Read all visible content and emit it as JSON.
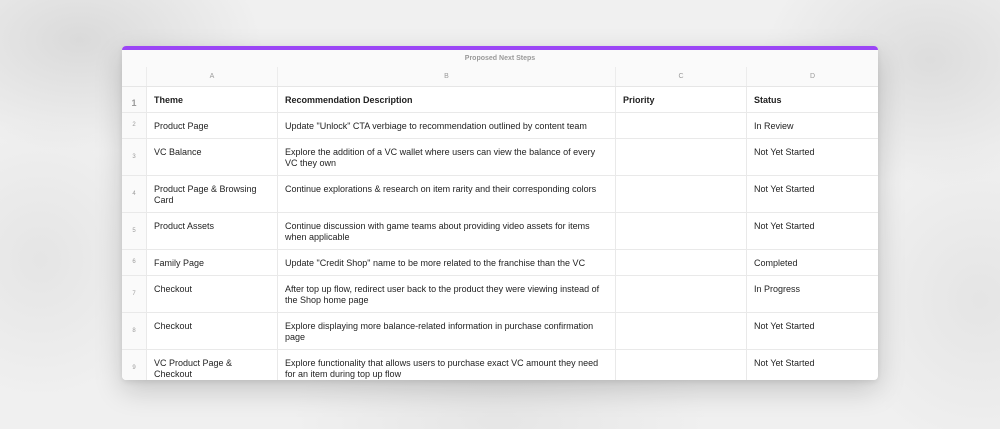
{
  "sheet": {
    "title": "Proposed Next Steps",
    "accent_color": "#9b46f5",
    "column_letters": [
      "A",
      "B",
      "C",
      "D"
    ],
    "headers": {
      "row_number": "1",
      "theme": "Theme",
      "description": "Recommendation Description",
      "priority": "Priority",
      "status": "Status"
    },
    "rows": [
      {
        "num": "2",
        "theme": "Product Page",
        "description": "Update \"Unlock\" CTA verbiage to recommendation outlined by content team",
        "priority": "",
        "status": "In Review"
      },
      {
        "num": "3",
        "theme": "VC Balance",
        "description": "Explore the addition of a VC wallet where users can view the balance of every VC they own",
        "priority": "",
        "status": "Not Yet Started"
      },
      {
        "num": "4",
        "theme": "Product Page & Browsing Card",
        "description": "Continue explorations & research on item rarity and their corresponding colors",
        "priority": "",
        "status": "Not Yet Started"
      },
      {
        "num": "5",
        "theme": "Product Assets",
        "description": "Continue discussion with game teams about providing video assets for items when applicable",
        "priority": "",
        "status": "Not Yet Started"
      },
      {
        "num": "6",
        "theme": "Family Page",
        "description": "Update \"Credit Shop\" name to be more related to the franchise than the VC",
        "priority": "",
        "status": "Completed"
      },
      {
        "num": "7",
        "theme": "Checkout",
        "description": "After top up flow, redirect user back to the product they were viewing instead of the Shop home page",
        "priority": "",
        "status": "In Progress"
      },
      {
        "num": "8",
        "theme": "Checkout",
        "description": "Explore displaying more balance-related information in purchase confirmation page",
        "priority": "",
        "status": "Not Yet Started"
      },
      {
        "num": "9",
        "theme": "VC Product Page & Checkout",
        "description": "Explore functionality that allows users to purchase exact VC amount they need for an item during top up flow",
        "priority": "",
        "status": "Not Yet Started"
      }
    ]
  }
}
